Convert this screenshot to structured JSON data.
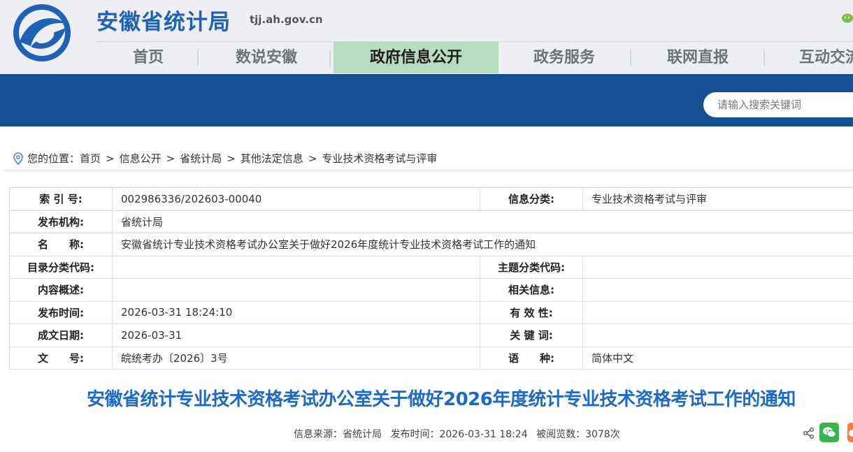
{
  "header": {
    "site_name": "安徽省统计局",
    "domain": "tjj.ah.gov.cn",
    "nav": [
      {
        "label": "首页"
      },
      {
        "label": "数说安徽"
      },
      {
        "label": "政府信息公开"
      },
      {
        "label": "政务服务"
      },
      {
        "label": "联网直报"
      },
      {
        "label": "互动交流"
      }
    ],
    "search_placeholder": "请输入搜索关键词"
  },
  "breadcrumb": {
    "prefix": "您的位置：",
    "items": [
      "首页",
      "信息公开",
      "省统计局",
      "其他法定信息",
      "专业技术资格考试与评审"
    ],
    "separator": ">"
  },
  "info_table": {
    "index_label": "索 引 号:",
    "index_value": "002986336/202603-00040",
    "category_label": "信息分类:",
    "category_value": "专业技术资格考试与评审",
    "publisher_label": "发布机构:",
    "publisher_value": "省统计局",
    "name_label": "名　　称:",
    "name_value": "安徽省统计专业技术资格考试办公室关于做好2026年度统计专业技术资格考试工作的通知",
    "catalog_label": "目录分类代码:",
    "catalog_value": "",
    "topic_label": "主题分类代码:",
    "topic_value": "",
    "summary_label": "内容概述:",
    "summary_value": "",
    "related_label": "相关信息:",
    "related_value": "",
    "pubtime_label": "发布时间:",
    "pubtime_value": "2026-03-31 18:24:10",
    "validity_label": "有 效 性:",
    "validity_value": "",
    "created_label": "成文日期:",
    "created_value": "2026-03-31",
    "keywords_label": "关 键 词:",
    "keywords_value": "",
    "docno_label": "文　　号:",
    "docno_value": "皖统考办〔2026〕3号",
    "lang_label": "语　　种:",
    "lang_value": "简体中文"
  },
  "article": {
    "title": "安徽省统计专业技术资格考试办公室关于做好2026年度统计专业技术资格考试工作的通知",
    "source": "信息来源：省统计局",
    "published": "发布时间：2026-03-31 18:24",
    "views": "被阅览数：3078次"
  },
  "colors": {
    "brand_blue": "#1d62b7",
    "band_blue": "#164f93",
    "nav_active_bg": "#b8dcc0",
    "title_blue": "#1b6ac9"
  },
  "icons": {
    "logo": "ah-stats-logo",
    "location": "location-pin-icon",
    "share": "share-icon",
    "wechat": "wechat-icon",
    "weibo": "weibo-icon"
  }
}
